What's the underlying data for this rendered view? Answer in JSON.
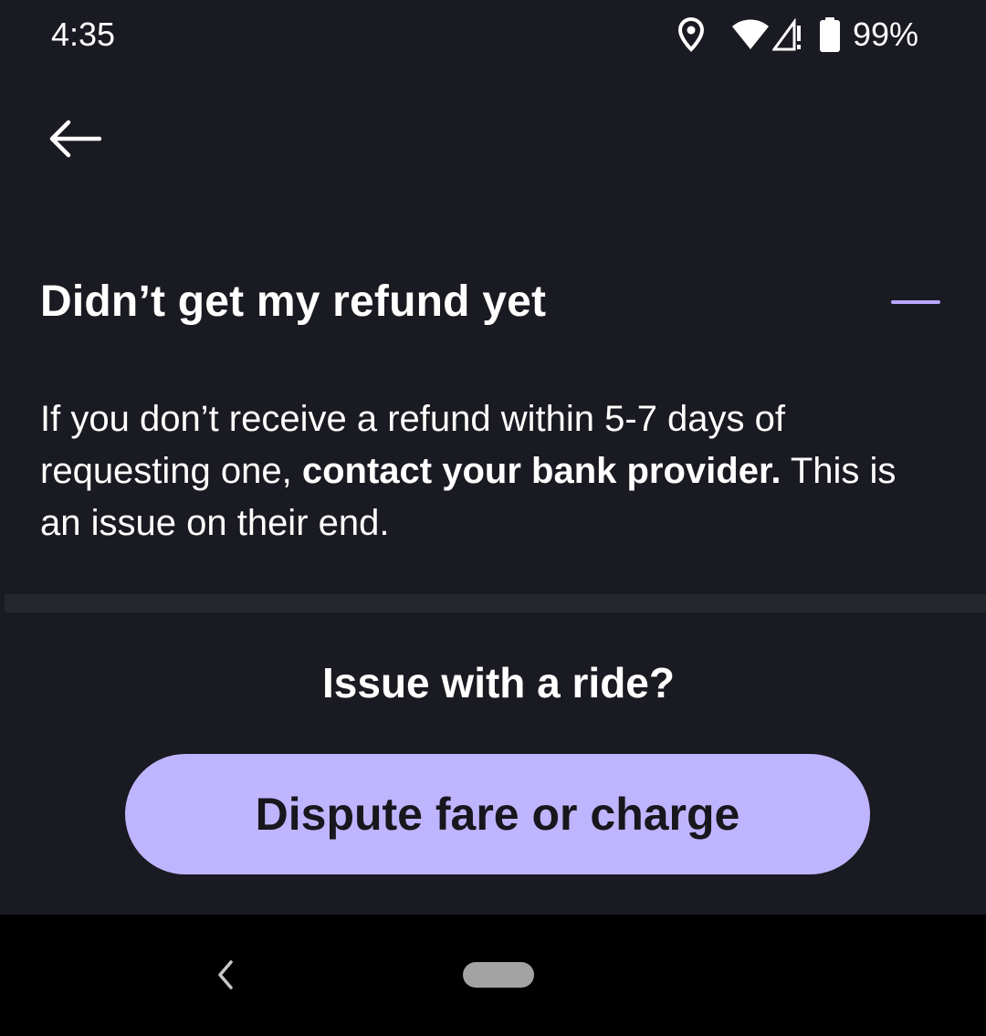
{
  "status_bar": {
    "time": "4:35",
    "battery": "99%",
    "icons": [
      "location-icon",
      "wifi-icon",
      "signal-icon",
      "battery-icon"
    ]
  },
  "header": {
    "back_icon": "arrow-left-icon"
  },
  "faq": {
    "title": "Didn’t get my refund yet",
    "toggle_icon": "minus-icon",
    "body_before": "If you don’t receive a refund within 5-7 days of requesting one, ",
    "body_bold": "contact your bank provider.",
    "body_after": " This is an issue on their end."
  },
  "issue": {
    "heading": "Issue with a ride?",
    "button_label": "Dispute fare or charge"
  },
  "nav_bar": {
    "back_icon": "chevron-left-icon",
    "home_icon": "home-pill-icon"
  },
  "colors": {
    "background": "#1a1a22",
    "accent": "#b9a6ff",
    "button": "#bfb5ff",
    "button_text": "#17171d",
    "divider": "#26272d"
  }
}
